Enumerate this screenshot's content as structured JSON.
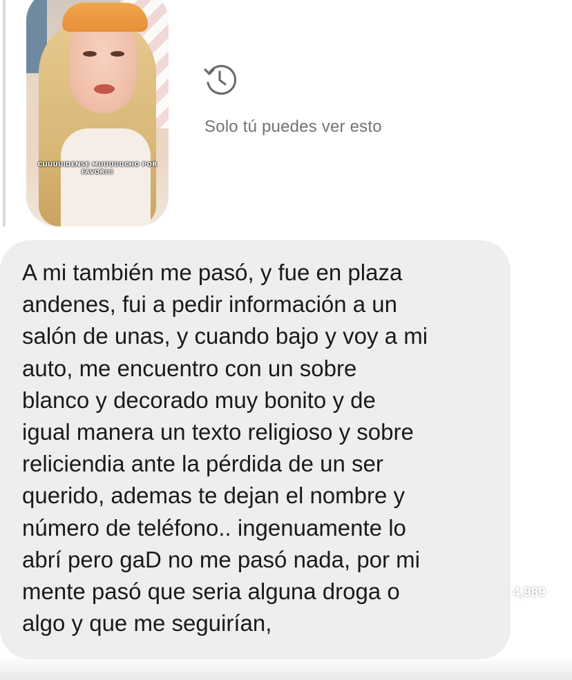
{
  "story": {
    "caption": "CUUUUIDENSE MUUUUUCHO POR FAVOR!!!"
  },
  "notice": {
    "icon": "history-icon",
    "text": "Solo tú puedes ver esto"
  },
  "message": {
    "text": "A mi también me pasó, y fue en plaza\nandenes, fui a pedir información a un\nsalón de unas, y cuando bajo y voy a mi\nauto, me encuentro con un sobre\nblanco y decorado muy bonito y de\nigual manera un texto religioso y sobre\nreliciendia ante la pérdida de un ser\nquerido, ademas te dejan el nombre y\nnúmero de teléfono.. ingenuamente lo\nabrí pero gaD no me pasó nada, por mi\nmente pasó que seria alguna droga o\nalgo y que me seguirían,"
  },
  "actions": {
    "like_icon": "heart-icon",
    "like_count": "4,989",
    "comment_icon": "comment-icon"
  },
  "colors": {
    "bubble": "#eeeeee",
    "notice_text": "#737373",
    "message_text": "#1a1a1a",
    "overlay_icon": "#ffffff"
  }
}
